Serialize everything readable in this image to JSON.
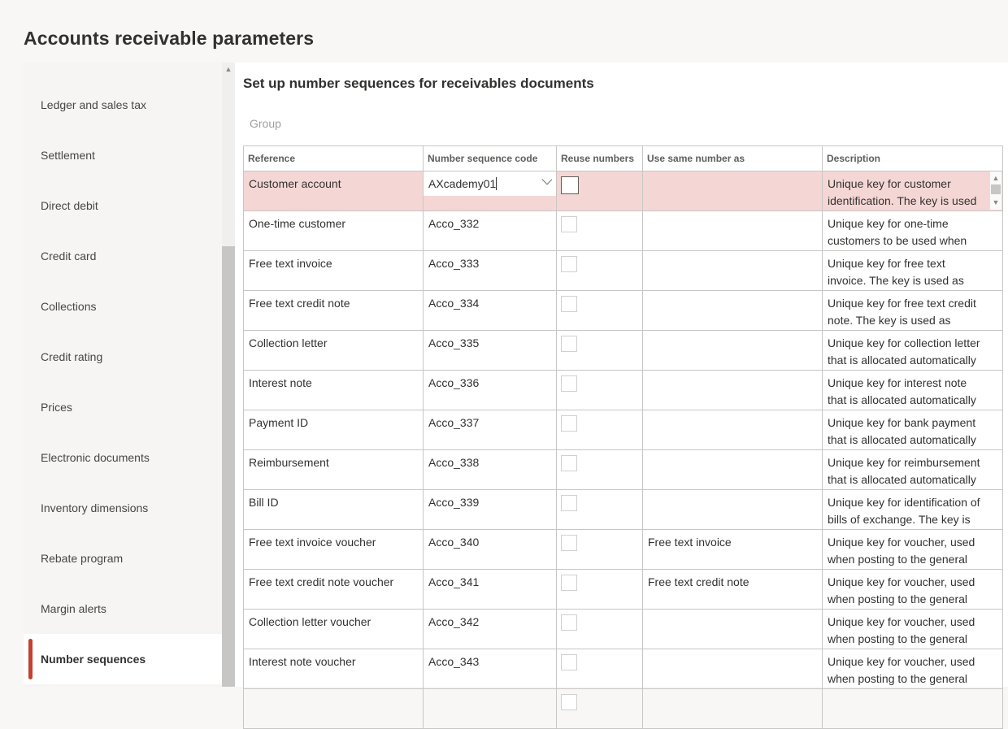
{
  "page_title": "Accounts receivable parameters",
  "sidebar": {
    "items": [
      {
        "label": "Ledger and sales tax",
        "active": false
      },
      {
        "label": "Settlement",
        "active": false
      },
      {
        "label": "Direct debit",
        "active": false
      },
      {
        "label": "Credit card",
        "active": false
      },
      {
        "label": "Collections",
        "active": false
      },
      {
        "label": "Credit rating",
        "active": false
      },
      {
        "label": "Prices",
        "active": false
      },
      {
        "label": "Electronic documents",
        "active": false
      },
      {
        "label": "Inventory dimensions",
        "active": false
      },
      {
        "label": "Rebate program",
        "active": false
      },
      {
        "label": "Margin alerts",
        "active": false
      },
      {
        "label": "Number sequences",
        "active": true
      }
    ]
  },
  "section": {
    "title": "Set up number sequences for receivables documents",
    "group_label": "Group"
  },
  "grid": {
    "headers": [
      "Reference",
      "Number sequence code",
      "Reuse numbers",
      "Use same number as",
      "Description"
    ],
    "rows": [
      {
        "reference": "Customer account",
        "code": "AXcademy01",
        "reuse": false,
        "same_as": "",
        "description": "Unique key for customer identification. The key is used"
      },
      {
        "reference": "One-time customer",
        "code": "Acco_332",
        "reuse": false,
        "same_as": "",
        "description": "Unique key for one-time customers to be used when"
      },
      {
        "reference": "Free text invoice",
        "code": "Acco_333",
        "reuse": false,
        "same_as": "",
        "description": "Unique key for free text invoice. The key is used as unique"
      },
      {
        "reference": "Free text credit note",
        "code": "Acco_334",
        "reuse": false,
        "same_as": "",
        "description": "Unique key for free text credit note. The key is used as unique"
      },
      {
        "reference": "Collection letter",
        "code": "Acco_335",
        "reuse": false,
        "same_as": "",
        "description": "Unique key for collection letter that is allocated automatically"
      },
      {
        "reference": "Interest note",
        "code": "Acco_336",
        "reuse": false,
        "same_as": "",
        "description": "Unique key for interest note that is allocated automatically when"
      },
      {
        "reference": "Payment ID",
        "code": "Acco_337",
        "reuse": false,
        "same_as": "",
        "description": "Unique key for bank payment that is allocated automatically"
      },
      {
        "reference": "Reimbursement",
        "code": "Acco_338",
        "reuse": false,
        "same_as": "",
        "description": "Unique key for reimbursement that is allocated automatically"
      },
      {
        "reference": "Bill ID",
        "code": "Acco_339",
        "reuse": false,
        "same_as": "",
        "description": "Unique key for identification of bills of exchange. The key is used"
      },
      {
        "reference": "Free text invoice voucher",
        "code": "Acco_340",
        "reuse": false,
        "same_as": "Free text invoice",
        "description": "Unique key for voucher, used when posting to the general"
      },
      {
        "reference": "Free text credit note voucher",
        "code": "Acco_341",
        "reuse": false,
        "same_as": "Free text credit note",
        "description": "Unique key for voucher, used when posting to the general"
      },
      {
        "reference": "Collection letter voucher",
        "code": "Acco_342",
        "reuse": false,
        "same_as": "",
        "description": "Unique key for voucher, used when posting to the general"
      },
      {
        "reference": "Interest note voucher",
        "code": "Acco_343",
        "reuse": false,
        "same_as": "",
        "description": "Unique key for voucher, used when posting to the general"
      },
      {
        "reference": "",
        "code": "",
        "reuse": false,
        "same_as": "",
        "description": ""
      }
    ]
  }
}
